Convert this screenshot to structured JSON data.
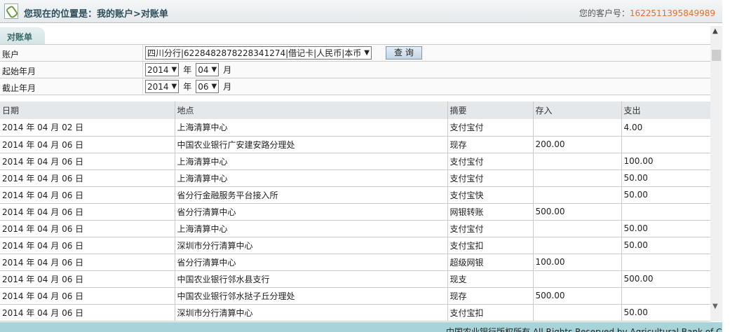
{
  "header": {
    "title": "您现在的位置是：我的账户>对账单",
    "customer_label": "您的客户号：",
    "customer_no": "1622511395849989"
  },
  "tab": "对账单",
  "form": {
    "account_label": "账户",
    "account_value": "四川分行|6228482878228341274|借记卡|人民币|本币",
    "query_button": "查 询",
    "start_label": "起始年月",
    "start_year": "2014",
    "start_month": "04",
    "end_label": "截止年月",
    "end_year": "2014",
    "end_month": "06",
    "year_unit": "年",
    "month_unit": "月"
  },
  "table": {
    "headers": [
      "日期",
      "地点",
      "摘要",
      "存入",
      "支出"
    ],
    "rows": [
      [
        "2014 年 04 月 02 日",
        "上海清算中心",
        "支付宝付",
        "",
        "4.00"
      ],
      [
        "2014 年 04 月 06 日",
        "中国农业银行广安建安路分理处",
        "现存",
        "200.00",
        ""
      ],
      [
        "2014 年 04 月 06 日",
        "上海清算中心",
        "支付宝付",
        "",
        "100.00"
      ],
      [
        "2014 年 04 月 06 日",
        "上海清算中心",
        "支付宝付",
        "",
        "50.00"
      ],
      [
        "2014 年 04 月 06 日",
        "省分行金融服务平台接入所",
        "支付宝快",
        "",
        "50.00"
      ],
      [
        "2014 年 04 月 06 日",
        "省分行清算中心",
        "网银转账",
        "500.00",
        ""
      ],
      [
        "2014 年 04 月 06 日",
        "上海清算中心",
        "支付宝付",
        "",
        "50.00"
      ],
      [
        "2014 年 04 月 06 日",
        "深圳市分行清算中心",
        "支付宝扣",
        "",
        "50.00"
      ],
      [
        "2014 年 04 月 06 日",
        "省分行清算中心",
        "超级网银",
        "100.00",
        ""
      ],
      [
        "2014 年 04 月 06 日",
        "中国农业银行邻水县支行",
        "现支",
        "",
        "500.00"
      ],
      [
        "2014 年 04 月 06 日",
        "中国农业银行邻水挞子丘分理处",
        "现存",
        "500.00",
        ""
      ],
      [
        "2014 年 04 月 06 日",
        "深圳市分行清算中心",
        "支付宝扣",
        "",
        "50.00"
      ]
    ]
  },
  "footer": "中国农业银行版权所有 All Rights Reserved by Agricultural Bank of China"
}
